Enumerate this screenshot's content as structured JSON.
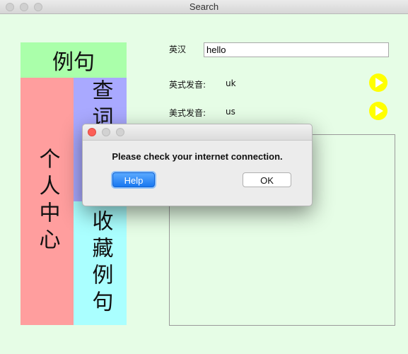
{
  "window": {
    "title": "Search"
  },
  "nav": {
    "example_sentences": "例句",
    "personal_center": "个人中心",
    "lookup": "查词",
    "favorite_sentences": "收藏例句"
  },
  "search": {
    "label": "英汉",
    "value": "hello"
  },
  "pronunciation": {
    "uk_label": "英式发音:",
    "uk_value": "uk",
    "us_label": "美式发音:",
    "us_value": "us"
  },
  "dialog": {
    "message": "Please check your internet connection.",
    "help_label": "Help",
    "ok_label": "OK"
  },
  "colors": {
    "background": "#e6fde6",
    "example": "#aaffaa",
    "personal": "#ff9e9e",
    "lookup": "#a9a9ff",
    "favorites": "#aaffff",
    "play": "#ffff00"
  }
}
